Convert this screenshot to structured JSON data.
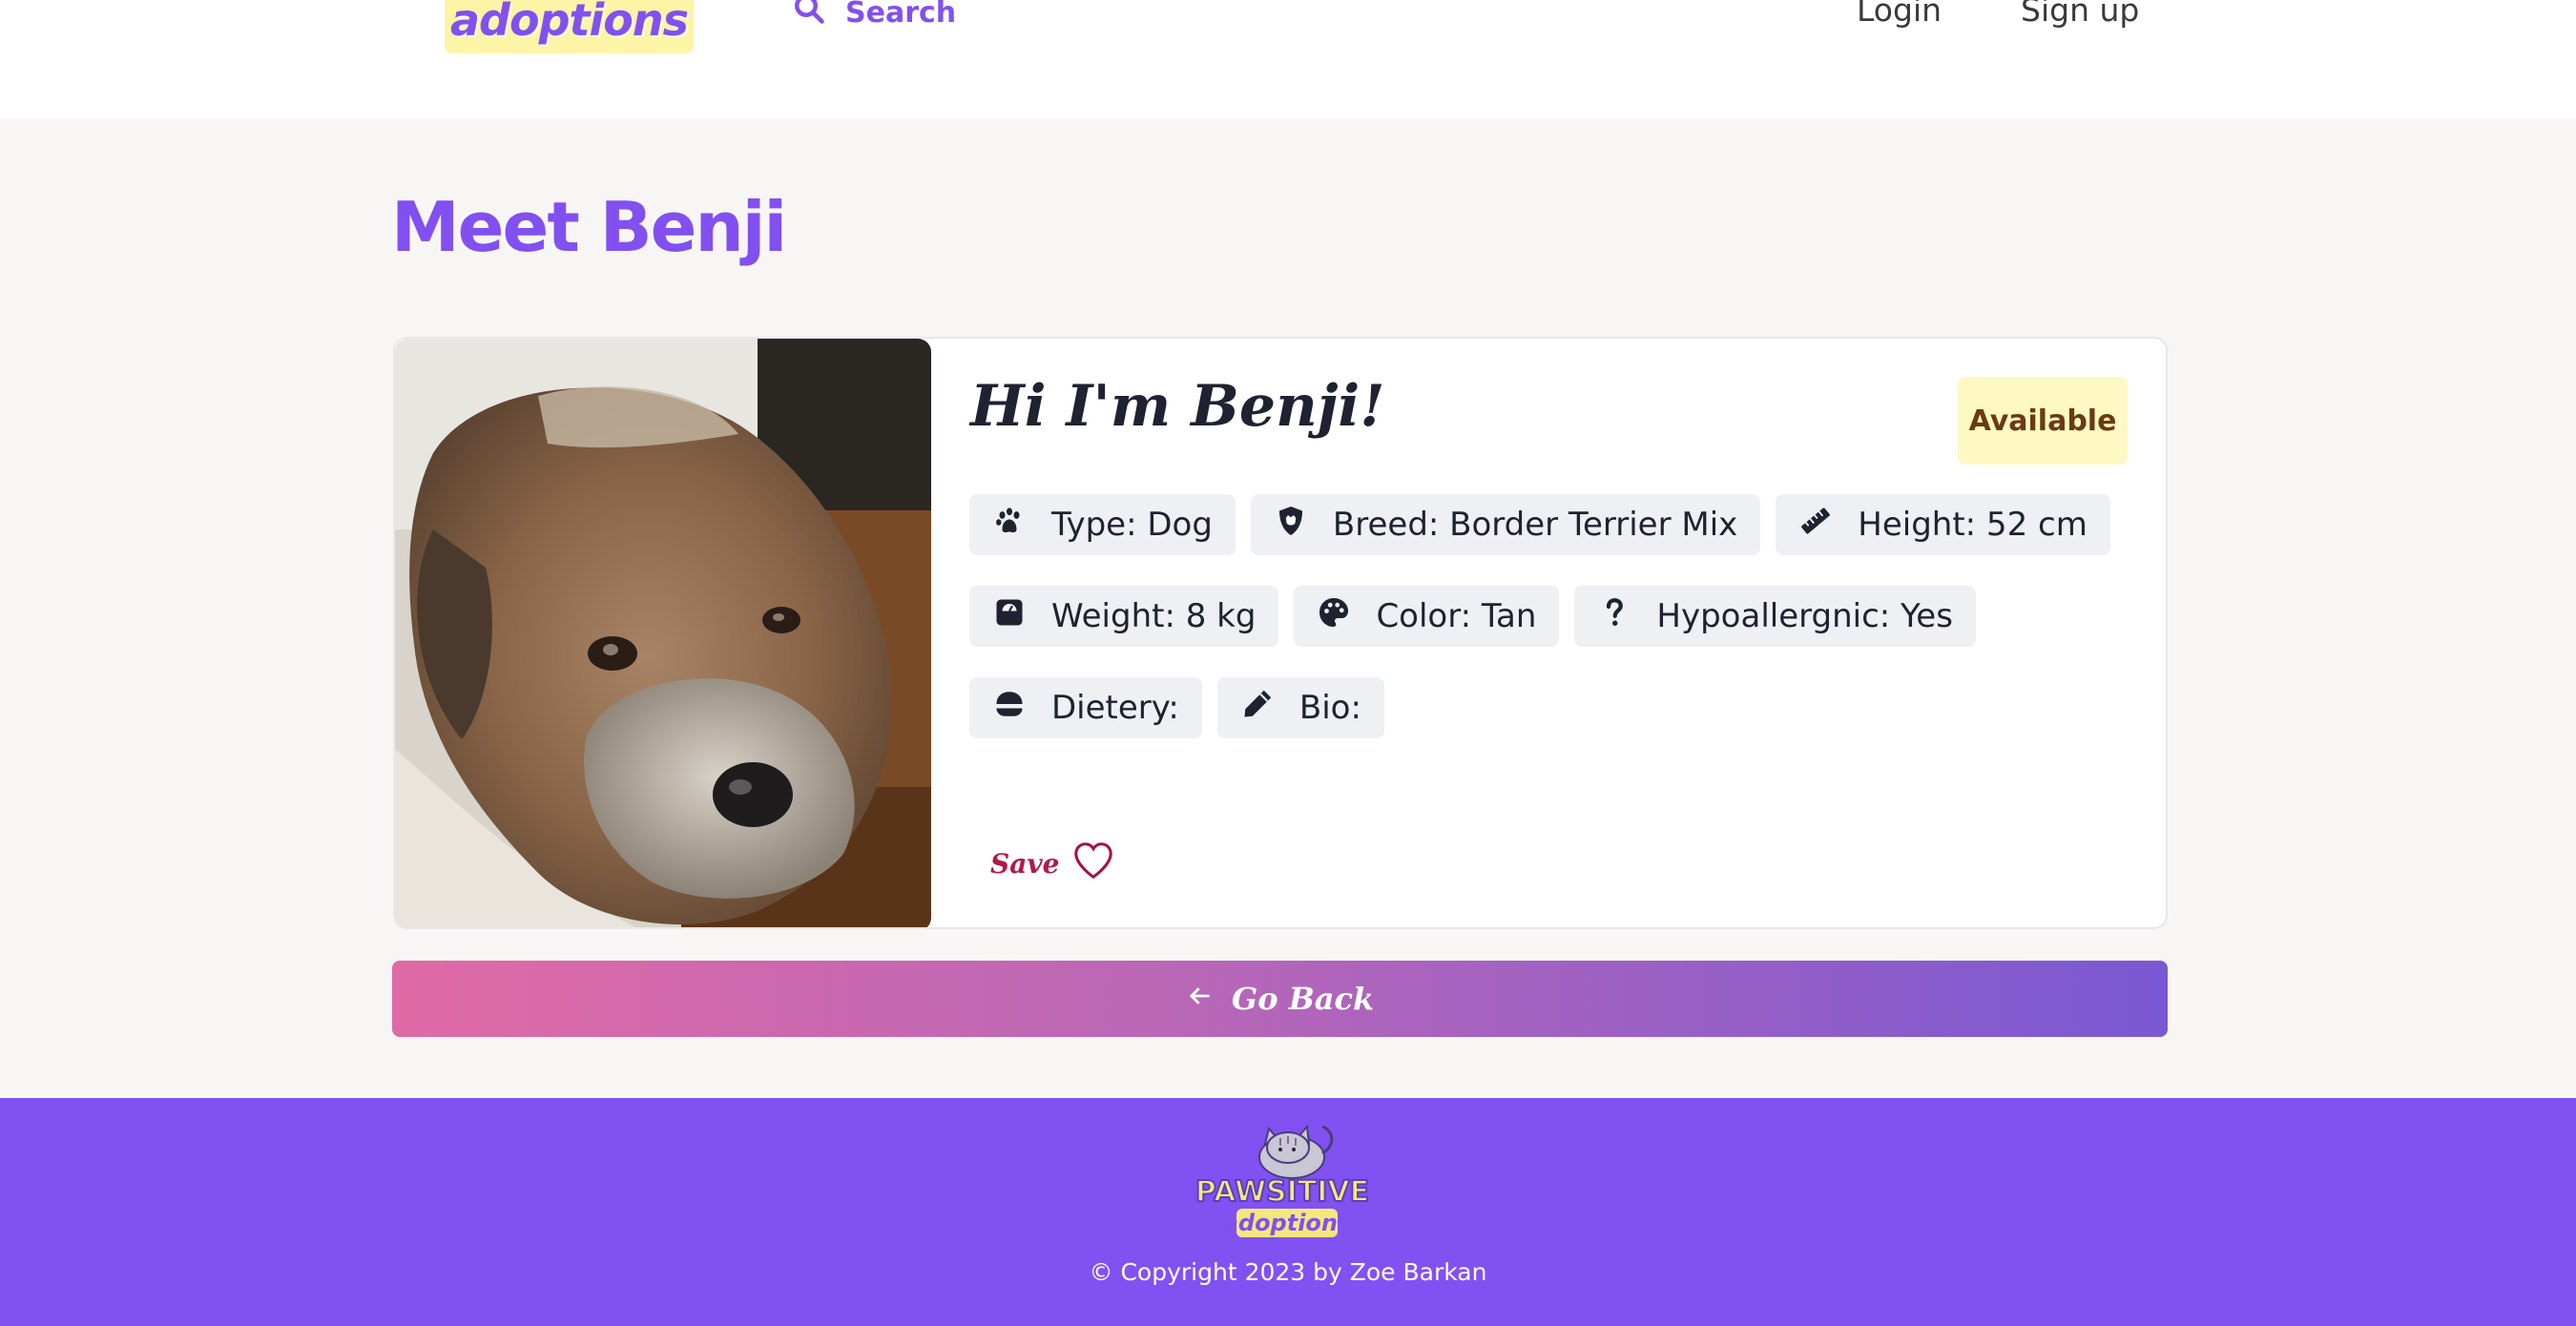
{
  "header": {
    "logo_text": "adoptions",
    "search_label": "Search",
    "login_label": "Login",
    "signup_label": "Sign up"
  },
  "page": {
    "title": "Meet Benji"
  },
  "pet": {
    "greeting": "Hi I'm Benji!",
    "status": "Available",
    "details": [
      {
        "icon": "paw-icon",
        "label": "Type: Dog"
      },
      {
        "icon": "shield-dog-icon",
        "label": "Breed: Border Terrier Mix"
      },
      {
        "icon": "ruler-icon",
        "label": "Height: 52 cm"
      },
      {
        "icon": "weight-scale-icon",
        "label": "Weight: 8 kg"
      },
      {
        "icon": "palette-icon",
        "label": "Color: Tan"
      },
      {
        "icon": "question-icon",
        "label": "Hypoallergnic: Yes"
      },
      {
        "icon": "bowl-food-icon",
        "label": "Dietery:"
      },
      {
        "icon": "pencil-icon",
        "label": "Bio:"
      }
    ],
    "save_label": "Save"
  },
  "actions": {
    "go_back_label": "Go Back"
  },
  "footer": {
    "logo_text_top": "PAWSITIVE",
    "logo_text_bottom": "adoptions",
    "copyright": "© Copyright 2023 by Zoe Barkan"
  },
  "colors": {
    "brand_purple": "#8250f0",
    "status_bg": "#fef9c3",
    "save_red": "#b4184b",
    "gradient_start": "#e06aa6",
    "gradient_end": "#7a58d3"
  }
}
